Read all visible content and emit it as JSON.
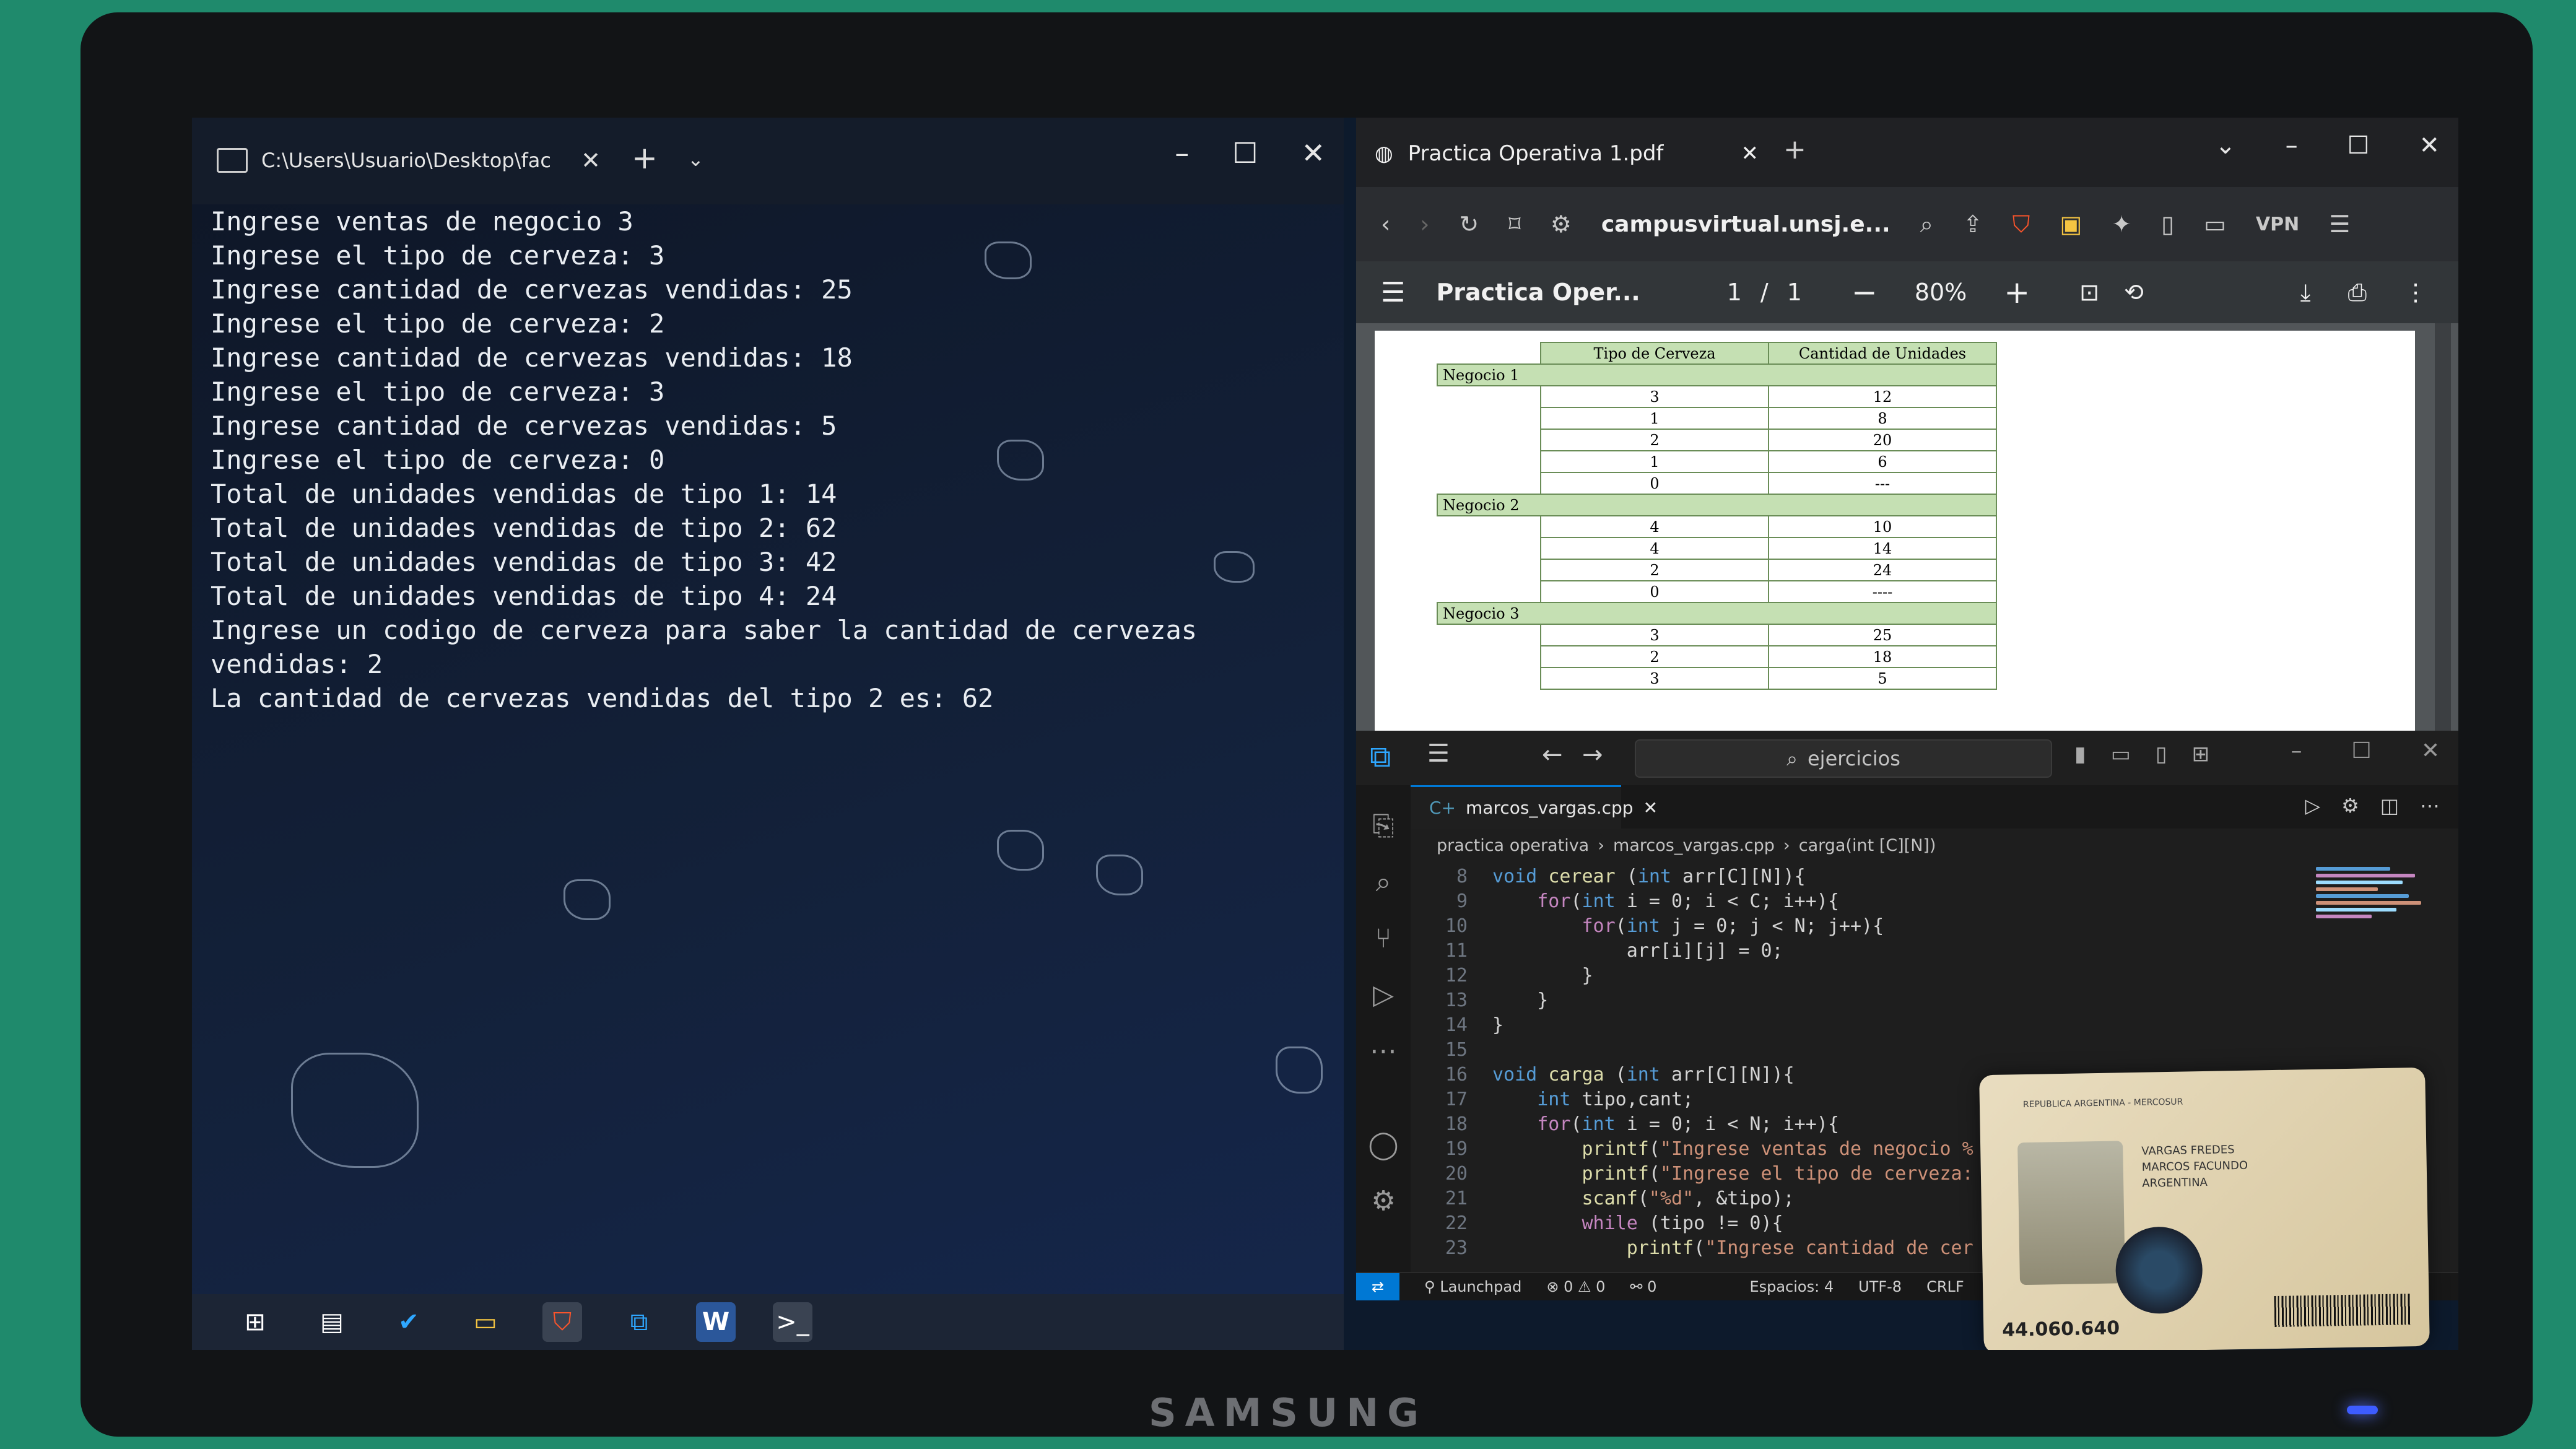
{
  "terminal": {
    "tab_title": "C:\\Users\\Usuario\\Desktop\\fac",
    "lines": [
      "Ingrese ventas de negocio 3",
      "Ingrese el tipo de cerveza: 3",
      "Ingrese cantidad de cervezas vendidas: 25",
      "Ingrese el tipo de cerveza: 2",
      "Ingrese cantidad de cervezas vendidas: 18",
      "Ingrese el tipo de cerveza: 3",
      "Ingrese cantidad de cervezas vendidas: 5",
      "Ingrese el tipo de cerveza: 0",
      "",
      "Total de unidades vendidas de tipo 1: 14",
      "",
      "Total de unidades vendidas de tipo 2: 62",
      "",
      "Total de unidades vendidas de tipo 3: 42",
      "",
      "Total de unidades vendidas de tipo 4: 24",
      "Ingrese un codigo de cerveza para saber la cantidad de cervezas",
      "vendidas: 2",
      "La cantidad de cervezas vendidas del tipo 2 es: 62"
    ]
  },
  "browser": {
    "tab_title": "Practica Operativa 1.pdf",
    "url": "campusvirtual.unsj.e...",
    "vpn_label": "VPN"
  },
  "pdf": {
    "doc_title": "Practica Oper...",
    "page_current": "1",
    "page_sep": "/",
    "page_total": "1",
    "zoom": "80%",
    "table": {
      "headers": [
        "Tipo de Cerveza",
        "Cantidad de Unidades"
      ],
      "groups": [
        {
          "label": "Negocio 1",
          "rows": [
            [
              "3",
              "12"
            ],
            [
              "1",
              "8"
            ],
            [
              "2",
              "20"
            ],
            [
              "1",
              "6"
            ],
            [
              "0",
              "---"
            ]
          ]
        },
        {
          "label": "Negocio 2",
          "rows": [
            [
              "4",
              "10"
            ],
            [
              "4",
              "14"
            ],
            [
              "2",
              "24"
            ],
            [
              "0",
              "----"
            ]
          ]
        },
        {
          "label": "Negocio 3",
          "rows": [
            [
              "3",
              "25"
            ],
            [
              "2",
              "18"
            ],
            [
              "3",
              "5"
            ]
          ]
        }
      ]
    }
  },
  "vscode": {
    "search": "ejercicios",
    "file_tab": "marcos_vargas.cpp",
    "breadcrumb": [
      "practica operativa",
      "marcos_vargas.cpp",
      "carga(int [C][N])"
    ],
    "code": [
      {
        "n": "8",
        "t": "void cerear (int arr[C][N]){"
      },
      {
        "n": "9",
        "t": "    for(int i = 0; i < C; i++){"
      },
      {
        "n": "10",
        "t": "        for(int j = 0; j < N; j++){"
      },
      {
        "n": "11",
        "t": "            arr[i][j] = 0;"
      },
      {
        "n": "12",
        "t": "        }"
      },
      {
        "n": "13",
        "t": "    }"
      },
      {
        "n": "14",
        "t": "}"
      },
      {
        "n": "15",
        "t": ""
      },
      {
        "n": "16",
        "t": "void carga (int arr[C][N]){"
      },
      {
        "n": "17",
        "t": "    int tipo,cant;"
      },
      {
        "n": "18",
        "t": "    for(int i = 0; i < N; i++){"
      },
      {
        "n": "19",
        "t": "        printf(\"Ingrese ventas de negocio %"
      },
      {
        "n": "20",
        "t": "        printf(\"Ingrese el tipo de cerveza:"
      },
      {
        "n": "21",
        "t": "        scanf(\"%d\", &tipo);"
      },
      {
        "n": "22",
        "t": "        while (tipo != 0){"
      },
      {
        "n": "23",
        "t": "            printf(\"Ingrese cantidad de cer"
      }
    ],
    "status": {
      "launchpad": "Launchpad",
      "errors": "0",
      "warnings": "0",
      "ports": "0",
      "spaces": "Espacios: 4",
      "encoding": "UTF-8",
      "eol": "CRLF"
    }
  },
  "id_card": {
    "header": "REPUBLICA ARGENTINA - MERCOSUR",
    "surname": "VARGAS FREDES",
    "given": "MARCOS FACUNDO",
    "nationality": "ARGENTINA",
    "doc_number": "44.060.640"
  },
  "monitor_brand": "SAMSUNG",
  "colors": {
    "accent": "#0078d4",
    "table_header": "#c5e0b3",
    "desk": "#1f8a6c"
  }
}
